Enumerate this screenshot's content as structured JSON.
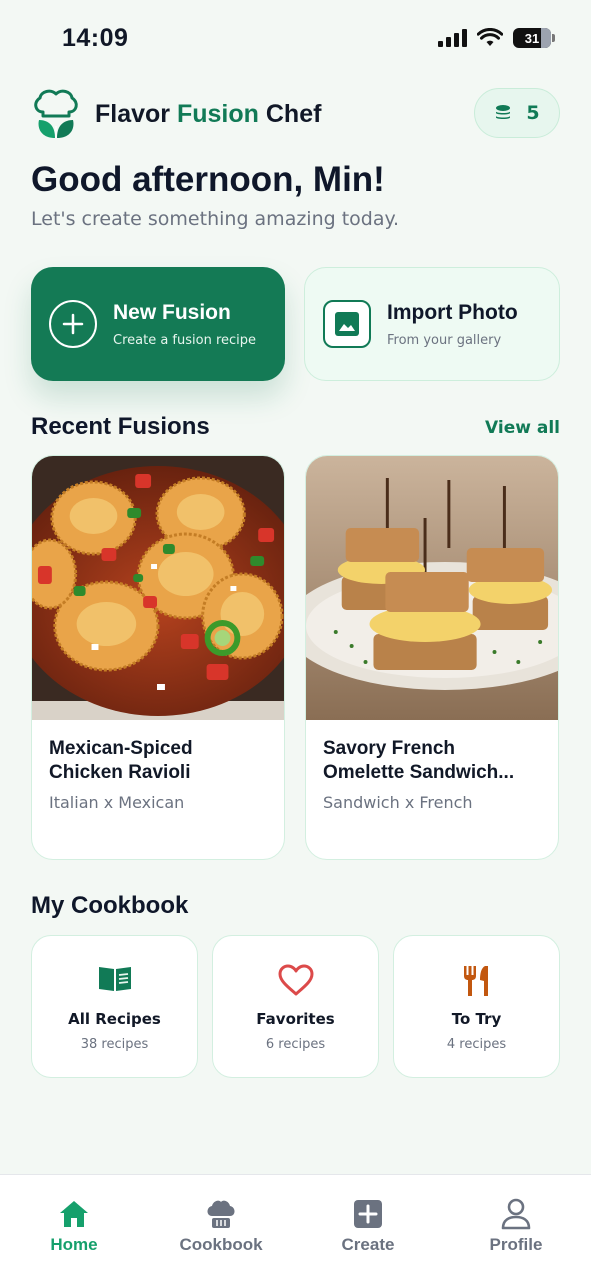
{
  "status_bar": {
    "time": "14:09",
    "battery": "31"
  },
  "header": {
    "title_part1": "Flavor ",
    "title_accent": "Fusion",
    "title_part2": " Chef",
    "credits": "5",
    "logo_icon": "chef-hat-leaf-icon",
    "credits_icon": "coin-stack-icon"
  },
  "greeting": {
    "title": "Good afternoon, Min!",
    "subtitle": "Let's create something amazing today."
  },
  "actions": [
    {
      "title": "New Fusion",
      "subtitle": "Create a fusion recipe",
      "icon": "plus-circle-icon"
    },
    {
      "title": "Import Photo",
      "subtitle": "From your gallery",
      "icon": "image-icon"
    }
  ],
  "recent": {
    "title": "Recent Fusions",
    "view_all": "View all",
    "items": [
      {
        "name": "Mexican-Spiced\nChicken Ravioli",
        "tags": "Italian x Mexican"
      },
      {
        "name": "Savory French\nOmelette Sandwich...",
        "tags": "Sandwich x French"
      }
    ]
  },
  "cookbook": {
    "title": "My Cookbook",
    "tiles": [
      {
        "label": "All Recipes",
        "count": "38 recipes",
        "icon": "book-icon"
      },
      {
        "label": "Favorites",
        "count": "6 recipes",
        "icon": "heart-icon"
      },
      {
        "label": "To Try",
        "count": "4 recipes",
        "icon": "fork-knife-icon"
      }
    ]
  },
  "tabs": [
    {
      "label": "Home",
      "icon": "home-icon",
      "active": true
    },
    {
      "label": "Cookbook",
      "icon": "chef-hat-icon",
      "active": false
    },
    {
      "label": "Create",
      "icon": "plus-square-icon",
      "active": false
    },
    {
      "label": "Profile",
      "icon": "user-icon",
      "active": false
    }
  ],
  "colors": {
    "brand": "#117a56",
    "brand_button": "#147a55",
    "active_tab": "#16a06c",
    "background": "#f3f8f4",
    "heart": "#dc4a4a",
    "fork": "#c2570f"
  }
}
